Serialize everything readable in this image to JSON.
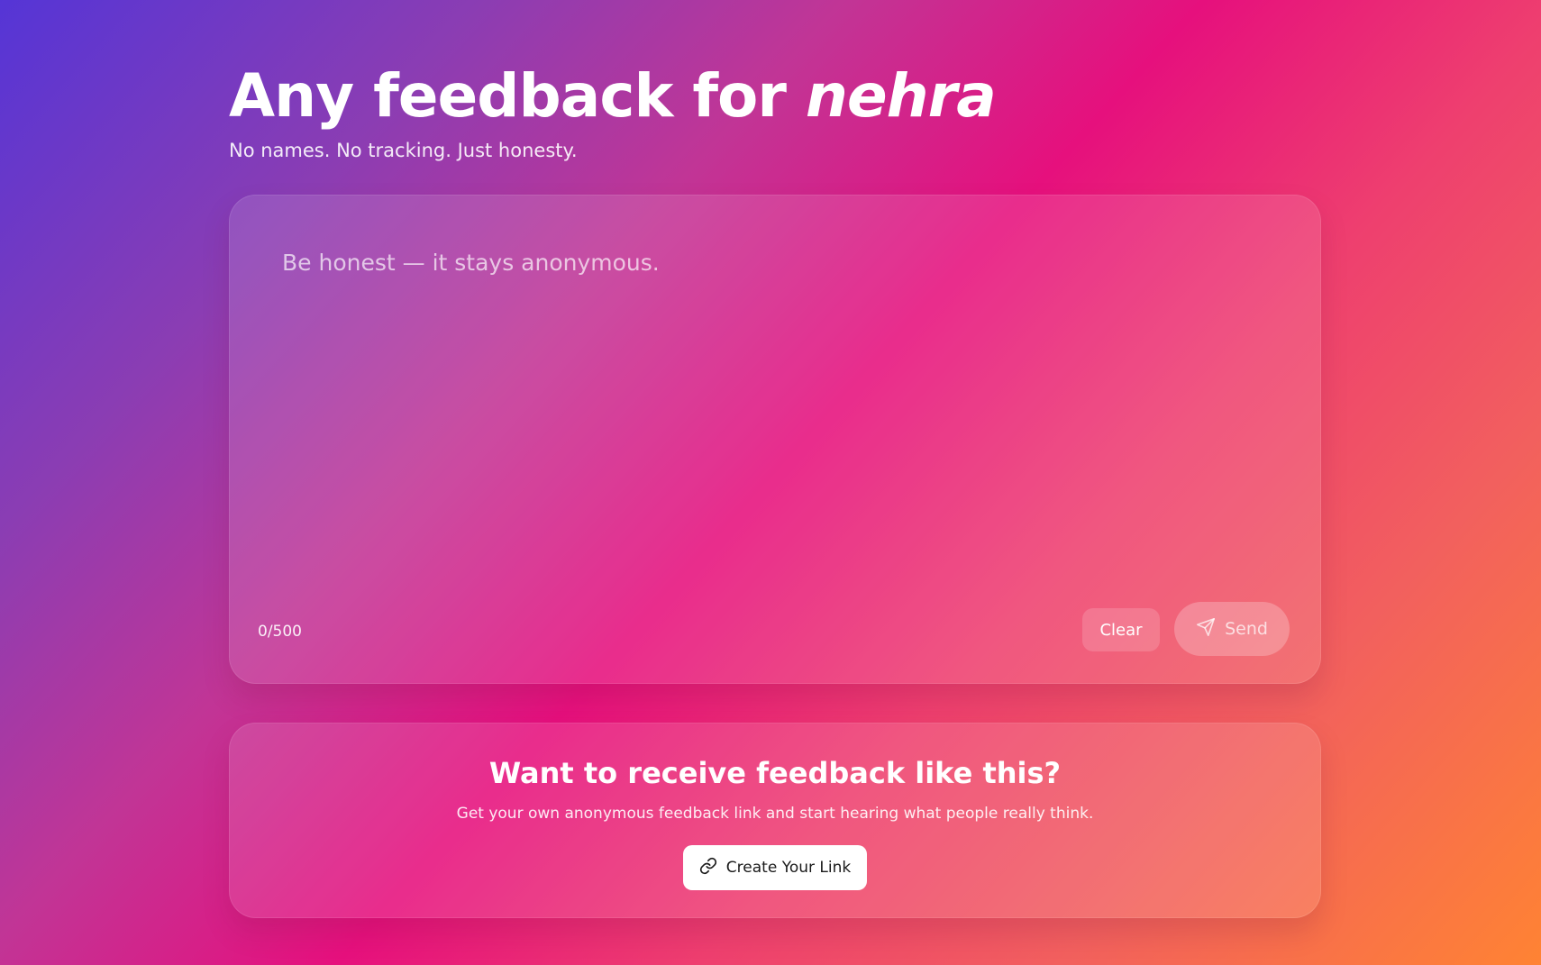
{
  "header": {
    "title_prefix": "Any feedback for",
    "recipient_name": "nehra",
    "subtitle": "No names. No tracking. Just honesty."
  },
  "composer": {
    "placeholder": "Be honest — it stays anonymous.",
    "value": "",
    "counter": "0/500",
    "clear_label": "Clear",
    "send_label": "Send",
    "send_icon": "send-icon"
  },
  "promo": {
    "title": "Want to receive feedback like this?",
    "text": "Get your own anonymous feedback link and start hearing what people really think.",
    "button_label": "Create Your Link",
    "button_icon": "link-icon"
  },
  "colors": {
    "gradient_start": "#5535d6",
    "gradient_mid": "#e6107d",
    "gradient_end": "#ff8333",
    "button_bg": "#ffffff"
  }
}
